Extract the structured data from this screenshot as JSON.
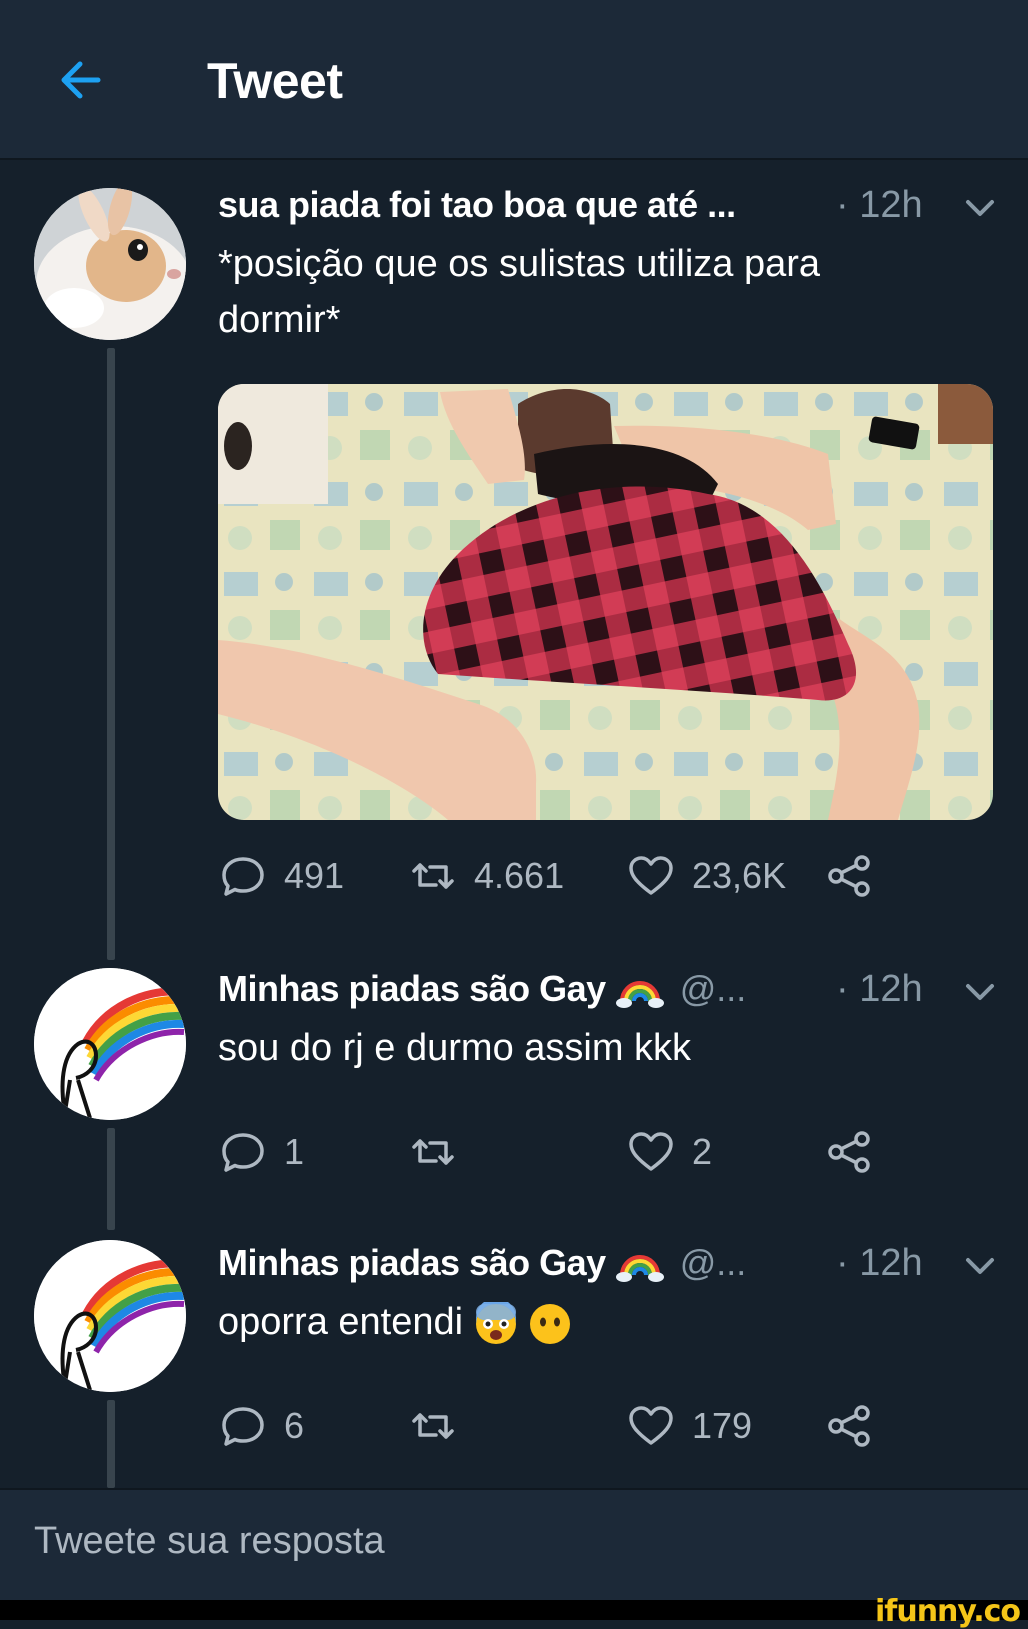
{
  "header": {
    "title": "Tweet",
    "back_icon": "arrow-left-icon",
    "accent_color": "#1da1f2"
  },
  "tweets": [
    {
      "name": "sua piada foi tao boa que até ...",
      "handle": "",
      "time": "· 12h",
      "text_line1": "*posição que os sulistas utiliza para",
      "text_line2": "dormir*",
      "avatar": "rabbit-avatar",
      "has_media": true,
      "replies": "491",
      "retweets": "4.661",
      "likes": "23,6K"
    },
    {
      "name": "Minhas piadas são Gay",
      "name_emoji": "rainbow-emoji",
      "handle": "@...",
      "time": "· 12h",
      "text": "sou do rj e durmo assim kkk",
      "avatar": "rainbow-puke-avatar",
      "replies": "1",
      "retweets": "",
      "likes": "2"
    },
    {
      "name": "Minhas piadas são Gay",
      "name_emoji": "rainbow-emoji",
      "handle": "@...",
      "time": "· 12h",
      "text": "oporra entendi",
      "text_emojis": [
        "fearful-face-emoji",
        "face-without-mouth-emoji"
      ],
      "avatar": "rainbow-puke-avatar",
      "replies": "6",
      "retweets": "",
      "likes": "179"
    }
  ],
  "reply_bar": {
    "placeholder": "Tweete sua resposta"
  },
  "watermark": "ifunny.co"
}
